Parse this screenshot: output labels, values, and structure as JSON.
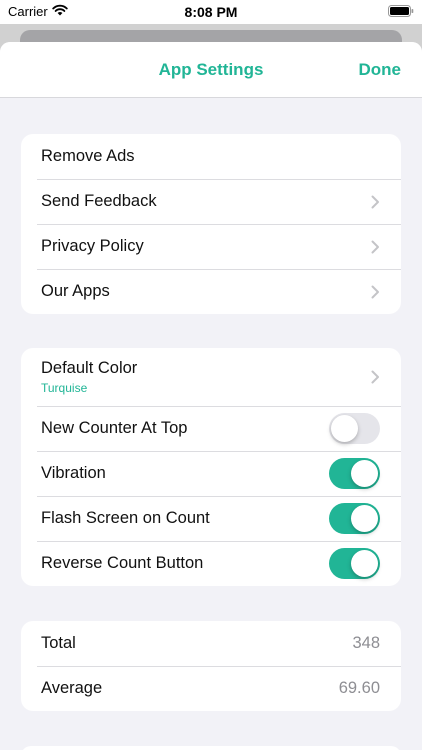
{
  "status_bar": {
    "carrier": "Carrier",
    "time": "8:08 PM"
  },
  "nav": {
    "title": "App Settings",
    "done_label": "Done"
  },
  "general_group": {
    "items": [
      {
        "label": "Remove Ads"
      },
      {
        "label": "Send Feedback"
      },
      {
        "label": "Privacy Policy"
      },
      {
        "label": "Our Apps"
      }
    ]
  },
  "preferences_group": {
    "default_color": {
      "label": "Default Color",
      "value": "Turquise"
    },
    "toggles": [
      {
        "label": "New Counter At Top",
        "on": false
      },
      {
        "label": "Vibration",
        "on": true
      },
      {
        "label": "Flash Screen on Count",
        "on": true
      },
      {
        "label": "Reverse Count Button",
        "on": true
      }
    ]
  },
  "stats_group": {
    "total": {
      "label": "Total",
      "value": "348"
    },
    "average": {
      "label": "Average",
      "value": "69.60"
    }
  },
  "colors": {
    "accent": "#21b596",
    "background": "#f2f2f7",
    "toggle_off": "#e5e5ea"
  }
}
